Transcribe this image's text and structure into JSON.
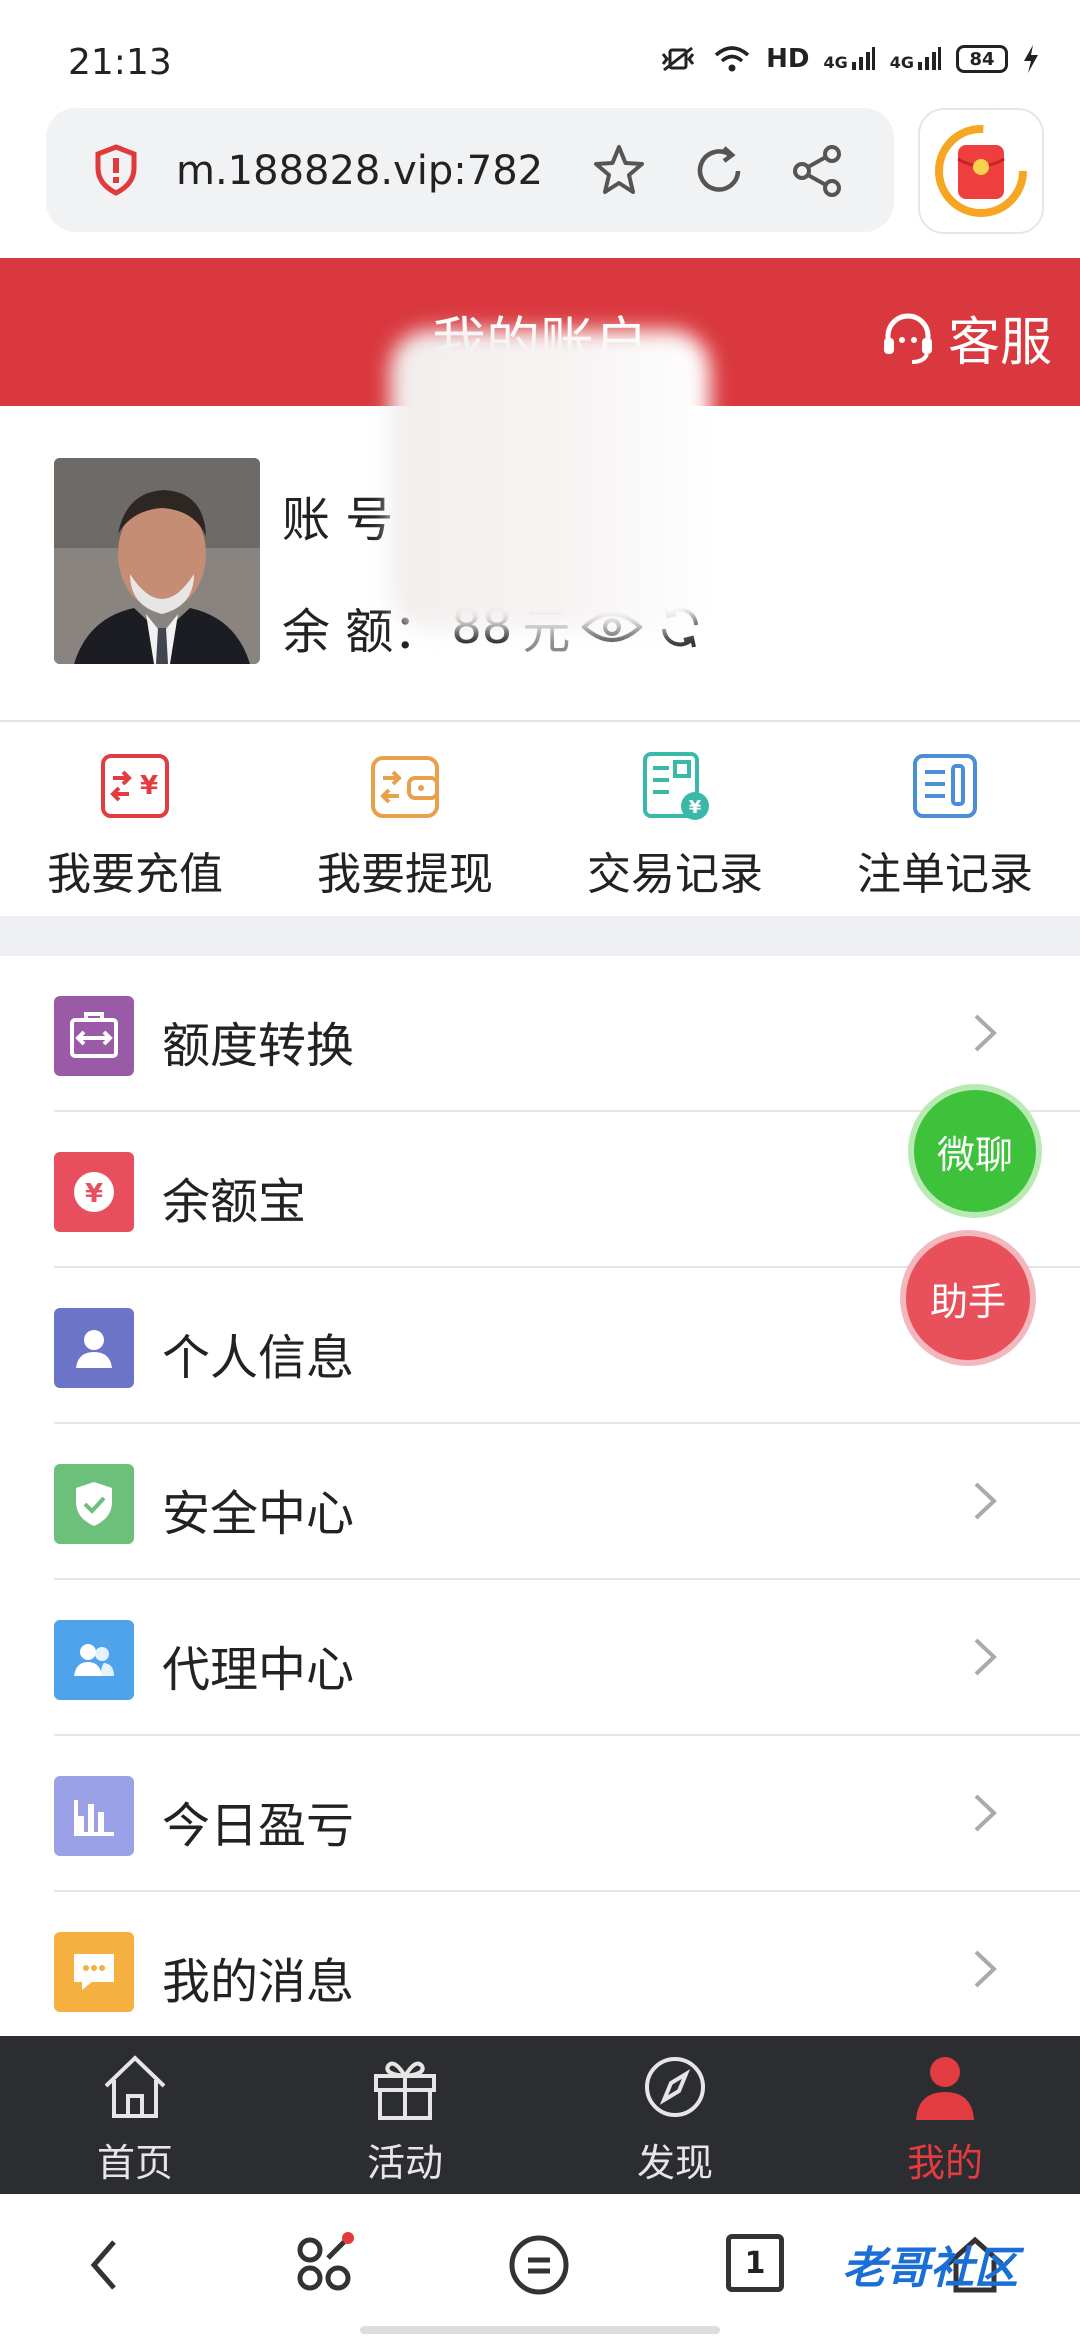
{
  "status_bar": {
    "time": "21:13",
    "network_label": "HD",
    "signal_1": "4G",
    "signal_2": "4G",
    "battery": "84"
  },
  "browser": {
    "url": "m.188828.vip:782",
    "icons": [
      "shield-icon",
      "star-icon",
      "refresh-icon",
      "share-icon",
      "red-envelope-icon"
    ]
  },
  "header": {
    "title": "我的账户",
    "service_label": "客服"
  },
  "profile": {
    "account_label": "账 号",
    "account_value": "",
    "balance_label": "余 额：",
    "balance_value": "88",
    "balance_unit": "元"
  },
  "quick_actions": [
    {
      "label": "我要充值",
      "icon": "recharge-icon",
      "color": "#e23b40"
    },
    {
      "label": "我要提现",
      "icon": "withdraw-icon",
      "color": "#e8a14a"
    },
    {
      "label": "交易记录",
      "icon": "transaction-record-icon",
      "color": "#3ab8a8"
    },
    {
      "label": "注单记录",
      "icon": "bet-record-icon",
      "color": "#4a8fd6"
    }
  ],
  "menu": [
    {
      "label": "额度转换",
      "icon": "transfer-icon",
      "color": "#9b5aa6"
    },
    {
      "label": "余额宝",
      "icon": "yuan-icon",
      "color": "#e84f5e"
    },
    {
      "label": "个人信息",
      "icon": "person-icon",
      "color": "#6c74c8"
    },
    {
      "label": "安全中心",
      "icon": "shield-check-icon",
      "color": "#6cc07a"
    },
    {
      "label": "代理中心",
      "icon": "group-icon",
      "color": "#4fa3ea"
    },
    {
      "label": "今日盈亏",
      "icon": "bar-chart-icon",
      "color": "#9aa1e6"
    },
    {
      "label": "我的消息",
      "icon": "message-icon",
      "color": "#f6b040"
    }
  ],
  "floating": {
    "chat_label": "微聊",
    "assistant_label": "助手"
  },
  "tabbar": [
    {
      "label": "首页",
      "icon": "home-icon"
    },
    {
      "label": "活动",
      "icon": "gift-icon"
    },
    {
      "label": "发现",
      "icon": "compass-icon"
    },
    {
      "label": "我的",
      "icon": "user-icon",
      "active": true
    }
  ],
  "navbar": {
    "tab_count": "1",
    "watermark": "老哥社区"
  }
}
